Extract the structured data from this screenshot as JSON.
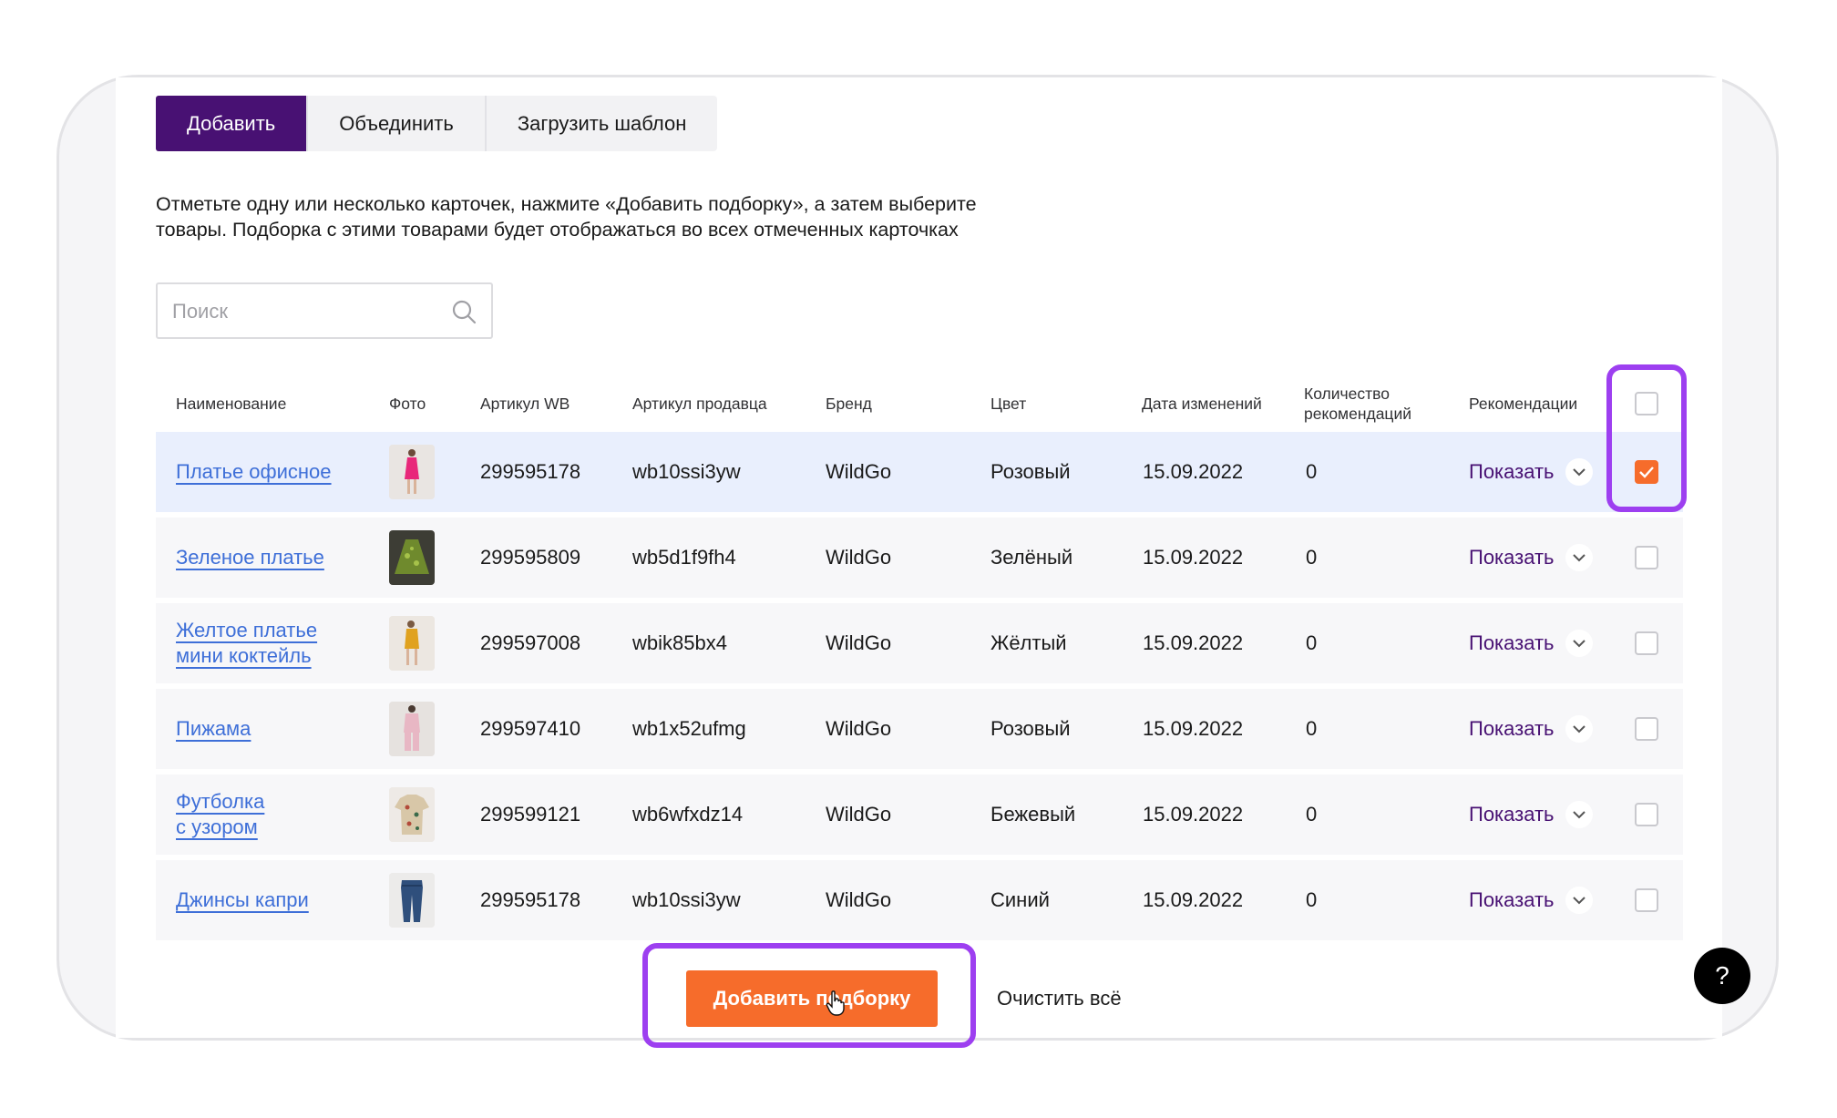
{
  "tabs": [
    {
      "label": "Добавить",
      "active": true
    },
    {
      "label": "Объединить",
      "active": false
    },
    {
      "label": "Загрузить шаблон",
      "active": false
    }
  ],
  "description": {
    "line1": "Отметьте одну или несколько карточек, нажмите «Добавить подборку», а затем выберите",
    "line2": "товары. Подборка с этими товарами будет отображаться во всех отмеченных карточках"
  },
  "search": {
    "placeholder": "Поиск",
    "value": ""
  },
  "table": {
    "headers": {
      "name": "Наименование",
      "photo": "Фото",
      "wb_article": "Артикул WB",
      "seller_article": "Артикул продавца",
      "brand": "Бренд",
      "color": "Цвет",
      "date": "Дата изменений",
      "count_line1": "Количество",
      "count_line2": "рекомендаций",
      "recommendations": "Рекомендации"
    },
    "rows": [
      {
        "name1": "Платье офисное",
        "name2": "",
        "wb": "299595178",
        "seller": "wb10ssi3yw",
        "brand": "WildGo",
        "color": "Розовый",
        "date": "15.09.2022",
        "count": "0",
        "show": "Показать",
        "checked": true,
        "photo_icon": "pink-dress-photo"
      },
      {
        "name1": "Зеленое платье",
        "name2": "",
        "wb": "299595809",
        "seller": "wb5d1f9fh4",
        "brand": "WildGo",
        "color": "Зелёный",
        "date": "15.09.2022",
        "count": "0",
        "show": "Показать",
        "checked": false,
        "photo_icon": "green-dress-photo"
      },
      {
        "name1": "Желтое платье",
        "name2": "мини коктейль",
        "wb": "299597008",
        "seller": "wbik85bx4",
        "brand": "WildGo",
        "color": "Жёлтый",
        "date": "15.09.2022",
        "count": "0",
        "show": "Показать",
        "checked": false,
        "photo_icon": "yellow-dress-photo"
      },
      {
        "name1": "Пижама",
        "name2": "",
        "wb": "299597410",
        "seller": "wb1x52ufmg",
        "brand": "WildGo",
        "color": "Розовый",
        "date": "15.09.2022",
        "count": "0",
        "show": "Показать",
        "checked": false,
        "photo_icon": "pajamas-photo"
      },
      {
        "name1": "Футболка",
        "name2": "с узором",
        "wb": "299599121",
        "seller": "wb6wfxdz14",
        "brand": "WildGo",
        "color": "Бежевый",
        "date": "15.09.2022",
        "count": "0",
        "show": "Показать",
        "checked": false,
        "photo_icon": "tshirt-photo"
      },
      {
        "name1": "Джинсы капри",
        "name2": "",
        "wb": "299595178",
        "seller": "wb10ssi3yw",
        "brand": "WildGo",
        "color": "Синий",
        "date": "15.09.2022",
        "count": "0",
        "show": "Показать",
        "checked": false,
        "photo_icon": "jeans-photo"
      }
    ]
  },
  "actions": {
    "add_collection": "Добавить подборку",
    "clear_all": "Очистить всё"
  },
  "help": {
    "label": "?"
  },
  "colors": {
    "accent_purple": "#481173",
    "accent_orange": "#f66c2b",
    "highlight": "#9d3ff0",
    "link_blue": "#3e6fd8"
  }
}
